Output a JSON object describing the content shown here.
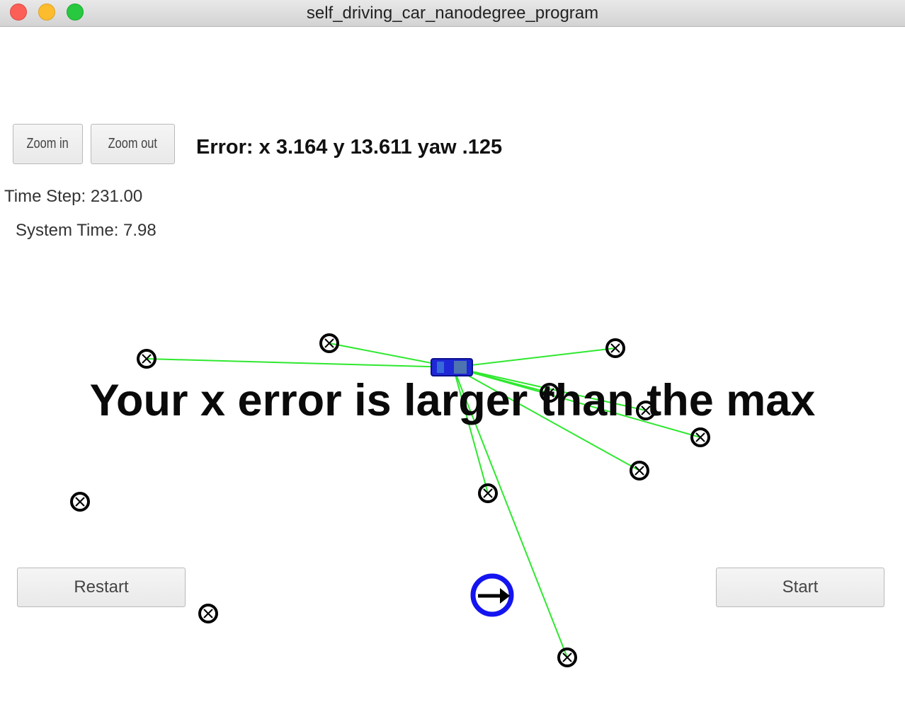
{
  "window": {
    "title": "self_driving_car_nanodegree_program"
  },
  "controls": {
    "zoom_in_label": "Zoom in",
    "zoom_out_label": "Zoom out",
    "restart_label": "Restart",
    "start_label": "Start"
  },
  "status": {
    "error_text": "Error: x 3.164 y 13.611 yaw .125",
    "time_step_text": "Time Step: 231.00",
    "system_time_text": "System Time: 7.98",
    "message": "Your x error is larger than the max"
  },
  "colors": {
    "observation_line": "#2ee82e",
    "vehicle": "#1f28d6",
    "landmark": "#000000",
    "ground_truth": "#1414f0"
  },
  "icons": {
    "landmark": "landmark-x-icon",
    "vehicle": "car-icon",
    "ground_truth": "ground-truth-arrow-icon"
  }
}
